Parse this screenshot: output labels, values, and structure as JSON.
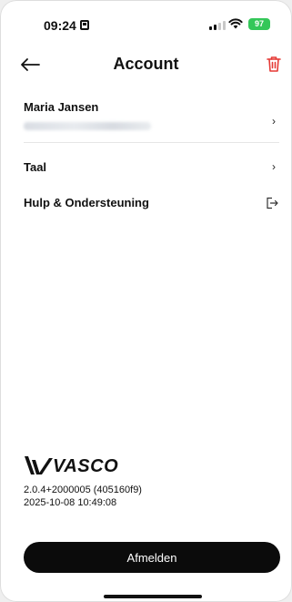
{
  "status_bar": {
    "time": "09:24",
    "battery": "97",
    "battery_color": "#34c759"
  },
  "header": {
    "title": "Account",
    "back_icon": "arrow-left-icon",
    "delete_icon": "trash-icon",
    "delete_color": "#e53935"
  },
  "profile": {
    "name": "Maria Jansen"
  },
  "menu": {
    "items": [
      {
        "label": "Taal",
        "icon": "chevron-right-icon"
      },
      {
        "label": "Hulp & Ondersteuning",
        "icon": "external-exit-icon"
      }
    ]
  },
  "footer": {
    "logo_text": "VASCO",
    "version": "2.0.4+2000005 (405160f9)",
    "build_date": "2025-10-08 10:49:08",
    "logout_label": "Afmelden"
  }
}
